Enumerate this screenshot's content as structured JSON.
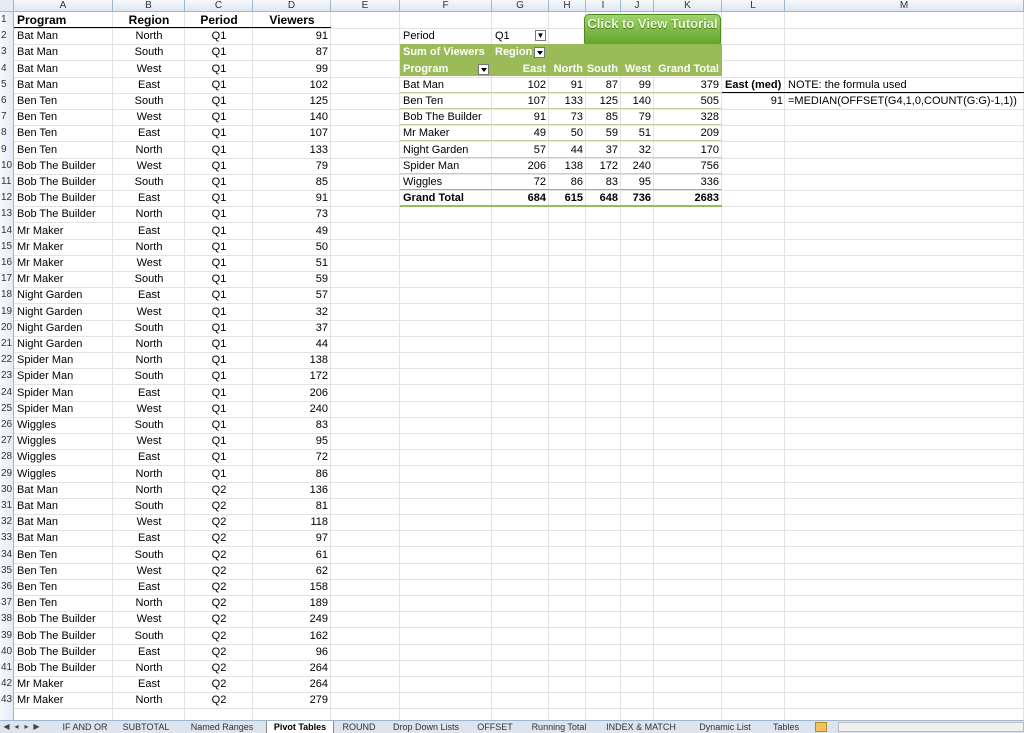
{
  "columns": [
    "A",
    "B",
    "C",
    "D",
    "E",
    "F",
    "G",
    "H",
    "I",
    "J",
    "K",
    "L",
    "M"
  ],
  "left_table": {
    "headers": [
      "Program",
      "Region",
      "Period",
      "Viewers"
    ],
    "rows": [
      [
        "Bat Man",
        "North",
        "Q1",
        "91"
      ],
      [
        "Bat Man",
        "South",
        "Q1",
        "87"
      ],
      [
        "Bat Man",
        "West",
        "Q1",
        "99"
      ],
      [
        "Bat Man",
        "East",
        "Q1",
        "102"
      ],
      [
        "Ben Ten",
        "South",
        "Q1",
        "125"
      ],
      [
        "Ben Ten",
        "West",
        "Q1",
        "140"
      ],
      [
        "Ben Ten",
        "East",
        "Q1",
        "107"
      ],
      [
        "Ben Ten",
        "North",
        "Q1",
        "133"
      ],
      [
        "Bob The Builder",
        "West",
        "Q1",
        "79"
      ],
      [
        "Bob The Builder",
        "South",
        "Q1",
        "85"
      ],
      [
        "Bob The Builder",
        "East",
        "Q1",
        "91"
      ],
      [
        "Bob The Builder",
        "North",
        "Q1",
        "73"
      ],
      [
        "Mr Maker",
        "East",
        "Q1",
        "49"
      ],
      [
        "Mr Maker",
        "North",
        "Q1",
        "50"
      ],
      [
        "Mr Maker",
        "West",
        "Q1",
        "51"
      ],
      [
        "Mr Maker",
        "South",
        "Q1",
        "59"
      ],
      [
        "Night Garden",
        "East",
        "Q1",
        "57"
      ],
      [
        "Night Garden",
        "West",
        "Q1",
        "32"
      ],
      [
        "Night Garden",
        "South",
        "Q1",
        "37"
      ],
      [
        "Night Garden",
        "North",
        "Q1",
        "44"
      ],
      [
        "Spider Man",
        "North",
        "Q1",
        "138"
      ],
      [
        "Spider Man",
        "South",
        "Q1",
        "172"
      ],
      [
        "Spider Man",
        "East",
        "Q1",
        "206"
      ],
      [
        "Spider Man",
        "West",
        "Q1",
        "240"
      ],
      [
        "Wiggles",
        "South",
        "Q1",
        "83"
      ],
      [
        "Wiggles",
        "West",
        "Q1",
        "95"
      ],
      [
        "Wiggles",
        "East",
        "Q1",
        "72"
      ],
      [
        "Wiggles",
        "North",
        "Q1",
        "86"
      ],
      [
        "Bat Man",
        "North",
        "Q2",
        "136"
      ],
      [
        "Bat Man",
        "South",
        "Q2",
        "81"
      ],
      [
        "Bat Man",
        "West",
        "Q2",
        "118"
      ],
      [
        "Bat Man",
        "East",
        "Q2",
        "97"
      ],
      [
        "Ben Ten",
        "South",
        "Q2",
        "61"
      ],
      [
        "Ben Ten",
        "West",
        "Q2",
        "62"
      ],
      [
        "Ben Ten",
        "East",
        "Q2",
        "158"
      ],
      [
        "Ben Ten",
        "North",
        "Q2",
        "189"
      ],
      [
        "Bob The Builder",
        "West",
        "Q2",
        "249"
      ],
      [
        "Bob The Builder",
        "South",
        "Q2",
        "162"
      ],
      [
        "Bob The Builder",
        "East",
        "Q2",
        "96"
      ],
      [
        "Bob The Builder",
        "North",
        "Q2",
        "264"
      ],
      [
        "Mr Maker",
        "East",
        "Q2",
        "264"
      ],
      [
        "Mr Maker",
        "North",
        "Q2",
        "279"
      ]
    ]
  },
  "filter": {
    "label": "Period",
    "value": "Q1"
  },
  "tutorial_button": "Click to View Tutorial",
  "pivot": {
    "sum_label": "Sum of Viewers",
    "col_field": "Region",
    "row_field": "Program",
    "headers": [
      "East",
      "North",
      "South",
      "West",
      "Grand Total"
    ],
    "rows": [
      [
        "Bat Man",
        "102",
        "91",
        "87",
        "99",
        "379"
      ],
      [
        "Ben Ten",
        "107",
        "133",
        "125",
        "140",
        "505"
      ],
      [
        "Bob The Builder",
        "91",
        "73",
        "85",
        "79",
        "328"
      ],
      [
        "Mr Maker",
        "49",
        "50",
        "59",
        "51",
        "209"
      ],
      [
        "Night Garden",
        "57",
        "44",
        "37",
        "32",
        "170"
      ],
      [
        "Spider Man",
        "206",
        "138",
        "172",
        "240",
        "756"
      ],
      [
        "Wiggles",
        "72",
        "86",
        "83",
        "95",
        "336"
      ]
    ],
    "total": [
      "Grand Total",
      "684",
      "615",
      "648",
      "736",
      "2683"
    ]
  },
  "median": {
    "label": "East (med)",
    "value": "91",
    "note": "NOTE: the formula used",
    "formula": "=MEDIAN(OFFSET(G4,1,0,COUNT(G:G)-1,1))"
  },
  "tabs": [
    "IF AND OR",
    "SUBTOTAL",
    "Named Ranges",
    "Pivot Tables",
    "ROUND",
    "Drop Down Lists",
    "OFFSET",
    "Running Total",
    "INDEX & MATCH",
    "Dynamic List",
    "Tables"
  ],
  "active_tab": "Pivot Tables",
  "colors": {
    "pivot_header": "#9bbb59",
    "grid": "#e3e3e3",
    "header_bg": "#dfe7f1"
  }
}
